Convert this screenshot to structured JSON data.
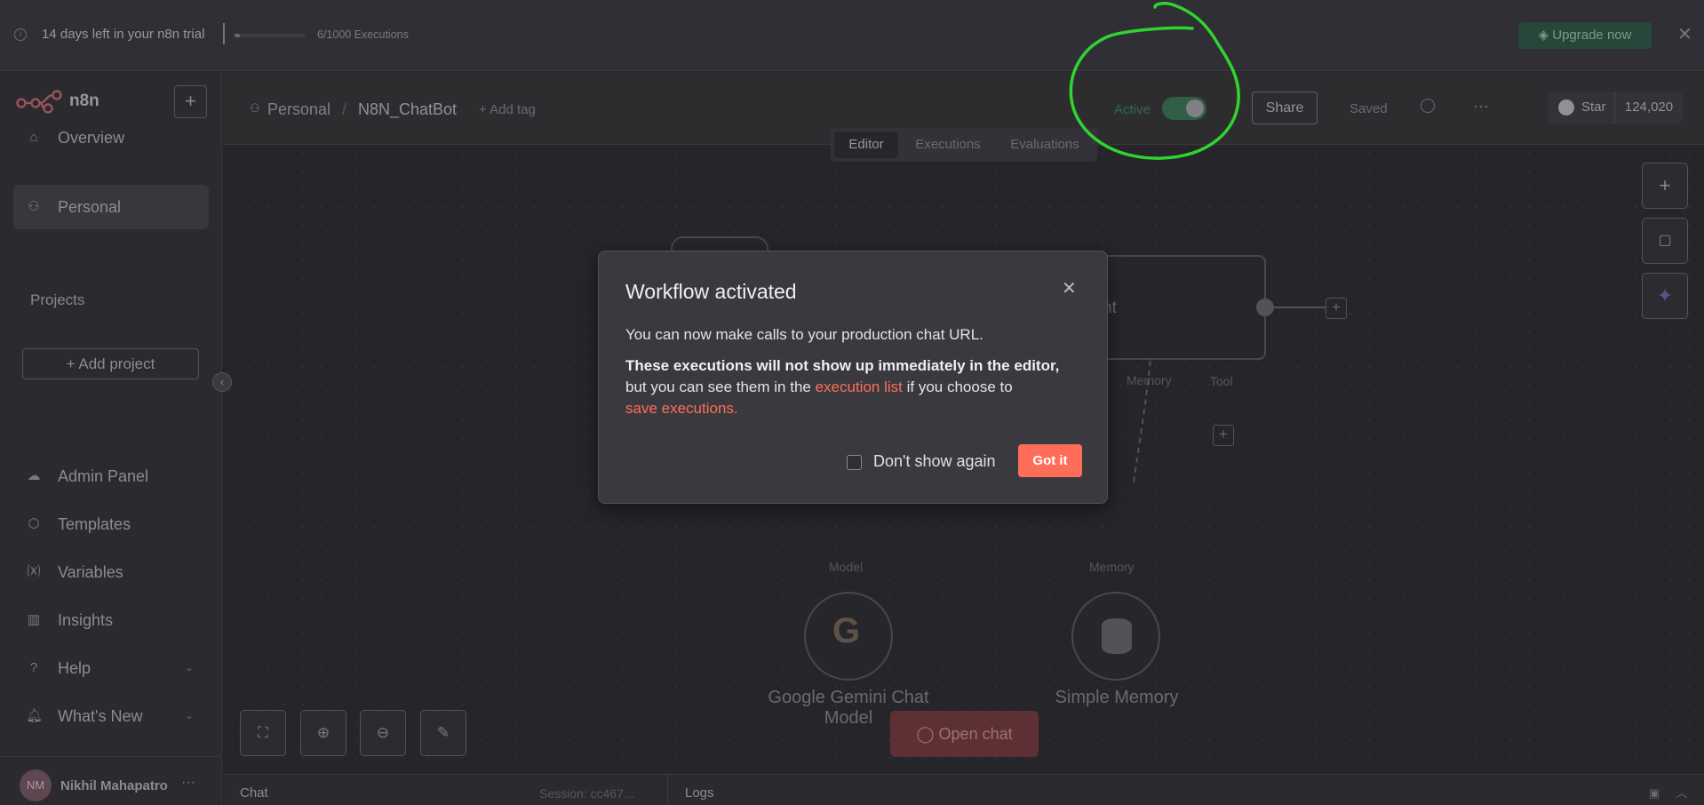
{
  "banner": {
    "trial_text": "14 days left in your n8n trial",
    "executions_text": "6/1000 Executions",
    "executions_used": 6,
    "executions_total": 1000,
    "upgrade_label": "Upgrade now",
    "close_icon": "close-icon",
    "info_icon": "info-icon"
  },
  "sidebar": {
    "app_name": "n8n",
    "items": [
      {
        "label": "Overview",
        "icon": "home-icon"
      },
      {
        "label": "Personal",
        "icon": "user-icon",
        "active": true
      }
    ],
    "projects_heading": "Projects",
    "add_project_label": "+ Add project",
    "bottom_items": [
      {
        "label": "Admin Panel",
        "icon": "cloud-icon"
      },
      {
        "label": "Templates",
        "icon": "box-icon"
      },
      {
        "label": "Variables",
        "icon": "variable-icon"
      },
      {
        "label": "Insights",
        "icon": "chart-icon"
      },
      {
        "label": "Help",
        "icon": "help-icon"
      },
      {
        "label": "What's New",
        "icon": "bell-icon"
      }
    ],
    "user_initials": "NM",
    "user_name": "Nikhil Mahapatro"
  },
  "header": {
    "breadcrumb_project": "Personal",
    "breadcrumb_sep": "/",
    "workflow_name": "N8N_ChatBot",
    "add_tag_label": "+ Add tag",
    "active_label": "Active",
    "active_state": true,
    "share_label": "Share",
    "saved_label": "Saved",
    "github_star_label": "Star",
    "github_star_count": "124,020"
  },
  "tabs": [
    "Editor",
    "Executions",
    "Evaluations"
  ],
  "selected_tab": "Editor",
  "canvas": {
    "agent_node_partial_title": "nt",
    "memory_sub_label": "Memory",
    "tool_sub_label": "Tool",
    "model_label": "Model",
    "memory_label": "Memory",
    "gemini_node_title_line1": "Google Gemini Chat",
    "gemini_node_title_line2": "Model",
    "memory_node_title": "Simple Memory",
    "open_chat_label": "Open chat"
  },
  "bottom_panel": {
    "chat_label": "Chat",
    "session_label": "Session: cc467...",
    "logs_label": "Logs"
  },
  "modal": {
    "title": "Workflow activated",
    "line1": "You can now make calls to your production chat URL.",
    "line2_bold": "These executions will not show up immediately in the editor,",
    "line3_prefix": "but you can see them in the ",
    "line3_link": "execution list",
    "line3_suffix": " if you choose to",
    "line4_link": "save executions.",
    "checkbox_label": "Don't show again",
    "checkbox_checked": false,
    "confirm_label": "Got it"
  },
  "colors": {
    "accent": "#ff6d5a",
    "active_green": "#3e7a58",
    "annotation_green": "#2fd42f"
  }
}
